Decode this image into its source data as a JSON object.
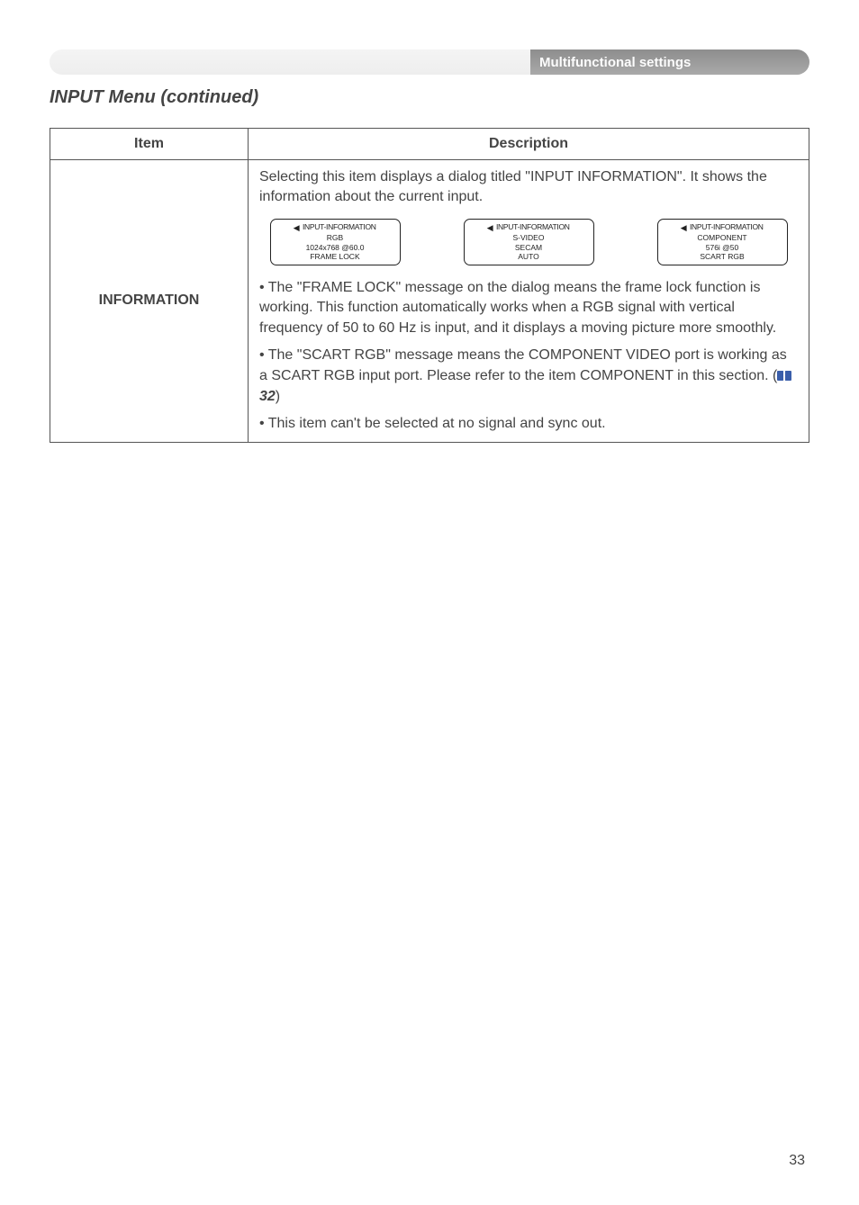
{
  "header": {
    "tab_title": "Multifunctional settings"
  },
  "section": {
    "title": "INPUT Menu (continued)"
  },
  "table": {
    "headers": {
      "item": "Item",
      "description": "Description"
    },
    "row": {
      "item": "INFORMATION",
      "desc_intro": "Selecting this item displays a dialog titled \"INPUT INFORMATION\". It shows the information about the current input.",
      "dialogs": [
        {
          "title": "INPUT-INFORMATION",
          "lines": [
            "RGB",
            "1024x768 @60.0",
            "FRAME LOCK"
          ]
        },
        {
          "title": "INPUT-INFORMATION",
          "lines": [
            "S-VIDEO",
            "SECAM",
            "AUTO"
          ]
        },
        {
          "title": "INPUT-INFORMATION",
          "lines": [
            "COMPONENT",
            "576i @50",
            "SCART RGB"
          ]
        }
      ],
      "bullet1": "• The \"FRAME LOCK\" message on the dialog means the frame lock function is working. This function automatically works when a RGB signal with vertical frequency of 50 to 60 Hz is input, and it displays a moving picture more smoothly.",
      "bullet2_pre": "• The \"SCART RGB\" message means the COMPONENT VIDEO port is working as a SCART RGB input port. Please refer to the item COMPONENT in this section. (",
      "bullet2_ref": "32",
      "bullet2_post": ")",
      "bullet3": "• This item can't be selected at no signal and sync out."
    }
  },
  "page_number": "33",
  "colors": {
    "accent": "#3a5eaa"
  }
}
